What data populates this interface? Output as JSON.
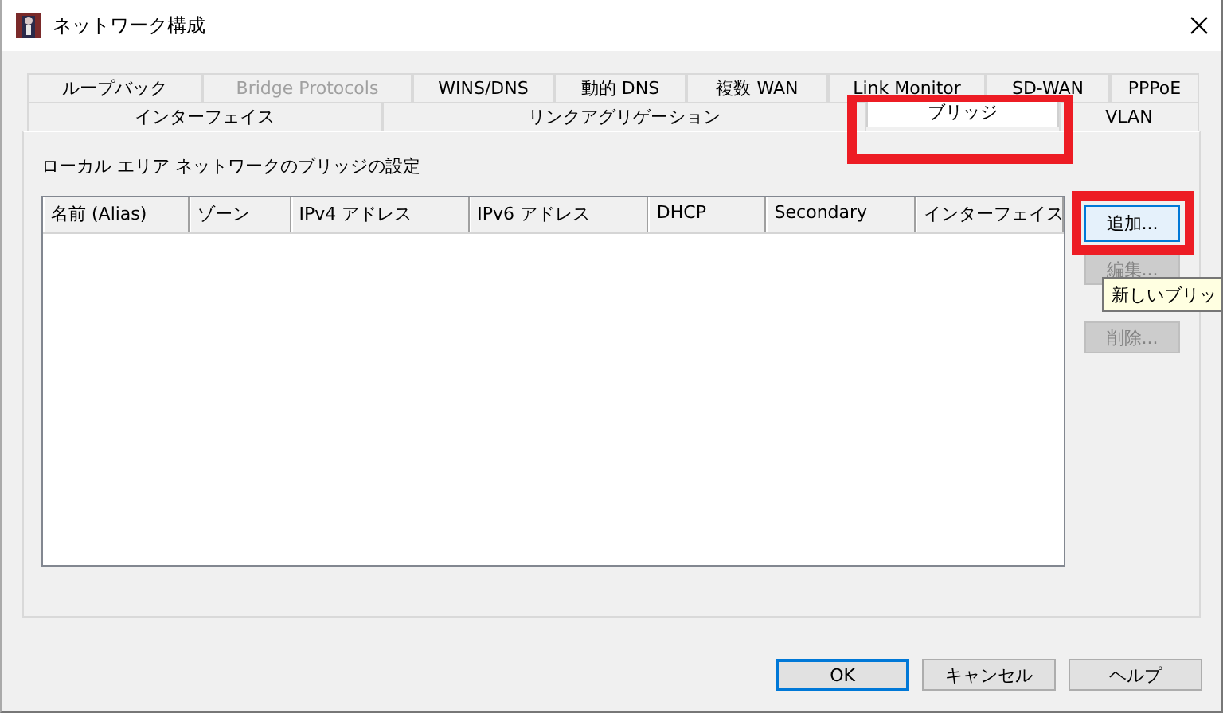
{
  "window": {
    "title": "ネットワーク構成"
  },
  "tab_rows": [
    [
      {
        "label": "ループバック",
        "selected": false,
        "disabled": false,
        "highlighted": false
      },
      {
        "label": "Bridge Protocols",
        "selected": false,
        "disabled": true,
        "highlighted": false
      },
      {
        "label": "WINS/DNS",
        "selected": false,
        "disabled": false,
        "highlighted": false
      },
      {
        "label": "動的 DNS",
        "selected": false,
        "disabled": false,
        "highlighted": false
      },
      {
        "label": "複数 WAN",
        "selected": false,
        "disabled": false,
        "highlighted": false
      },
      {
        "label": "Link Monitor",
        "selected": false,
        "disabled": false,
        "highlighted": false
      },
      {
        "label": "SD-WAN",
        "selected": false,
        "disabled": false,
        "highlighted": false
      },
      {
        "label": "PPPoE",
        "selected": false,
        "disabled": false,
        "highlighted": false
      }
    ],
    [
      {
        "label": "インターフェイス",
        "selected": false,
        "disabled": false,
        "highlighted": false
      },
      {
        "label": "リンクアグリゲーション",
        "selected": false,
        "disabled": false,
        "highlighted": false
      },
      {
        "label": "ブリッジ",
        "selected": true,
        "disabled": false,
        "highlighted": true
      },
      {
        "label": "VLAN",
        "selected": false,
        "disabled": false,
        "highlighted": false
      }
    ]
  ],
  "panel": {
    "heading": "ローカル エリア ネットワークのブリッジの設定"
  },
  "table": {
    "columns": [
      "名前 (Alias)",
      "ゾーン",
      "IPv4 アドレス",
      "IPv6 アドレス",
      "DHCP",
      "Secondary",
      "インターフェイス"
    ]
  },
  "side_buttons": [
    {
      "label": "追加...",
      "disabled": false,
      "focused": true,
      "highlighted": true
    },
    {
      "label": "編集...",
      "disabled": true,
      "focused": false,
      "highlighted": false
    },
    {
      "label": "削除...",
      "disabled": true,
      "focused": false,
      "highlighted": false
    }
  ],
  "tooltip": {
    "text": "新しいブリッ"
  },
  "buttons": [
    {
      "label": "OK",
      "default": true
    },
    {
      "label": "キャンセル",
      "default": false
    },
    {
      "label": "ヘルプ",
      "default": false
    }
  ]
}
